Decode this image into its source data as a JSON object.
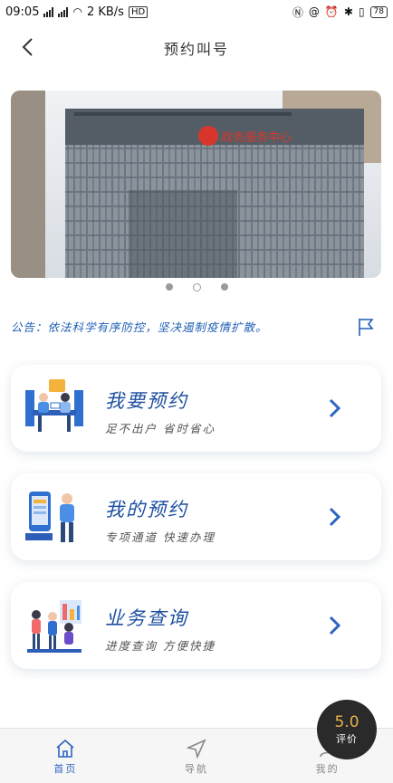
{
  "status_bar": {
    "time": "09:05",
    "net1": "4G",
    "net2": "2G",
    "speed": "2 KB/s",
    "hd": "HD",
    "battery": "78"
  },
  "header": {
    "title": "预约叫号"
  },
  "banner": {
    "slides": 3,
    "active_index": 1,
    "sign_text": "政务服务中心"
  },
  "notice": {
    "text": "公告：依法科学有序防控，坚决遏制疫情扩散。"
  },
  "cards": [
    {
      "title": "我要预约",
      "subtitle": "足不出户 省时省心",
      "icon": "appointment-illustration-icon"
    },
    {
      "title": "我的预约",
      "subtitle": "专项通道 快速办理",
      "icon": "my-appointment-illustration-icon"
    },
    {
      "title": "业务查询",
      "subtitle": "进度查询 方便快捷",
      "icon": "business-query-illustration-icon"
    }
  ],
  "bottom_nav": [
    {
      "label": "首页",
      "icon": "home-icon",
      "active": true
    },
    {
      "label": "导航",
      "icon": "navigation-icon",
      "active": false
    },
    {
      "label": "我的",
      "icon": "user-icon",
      "active": false
    }
  ],
  "rating": {
    "score": "5.0",
    "label": "评价"
  },
  "colors": {
    "accent": "#1d4fa0",
    "notice": "#1f5fb5",
    "rating_score": "#e7b24a"
  }
}
